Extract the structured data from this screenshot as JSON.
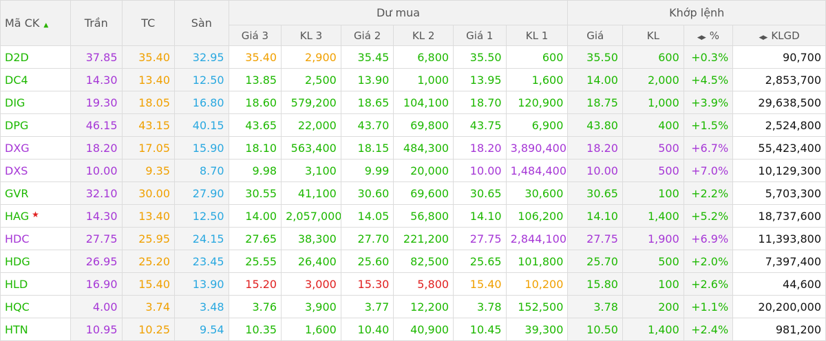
{
  "colors": {
    "ceiling": "#a637d6",
    "ref": "#f0a000",
    "floor": "#29a8e0",
    "up": "#1db800",
    "down": "#e02020",
    "neutral": "#111111"
  },
  "headers": {
    "symbol": "Mã CK",
    "ceiling": "Trần",
    "ref": "TC",
    "floor": "Sàn",
    "bid_group": "Dư mua",
    "match_group": "Khớp lệnh",
    "p3": "Giá 3",
    "v3": "KL 3",
    "p2": "Giá 2",
    "v2": "KL 2",
    "p1": "Giá 1",
    "v1": "KL 1",
    "mp": "Giá",
    "mv": "KL",
    "pct": "%",
    "total": "KLGD"
  },
  "icons": {
    "sort": "sort-up-icon",
    "toggle": "toggle-arrows-icon",
    "star": "star-icon"
  },
  "rows": [
    {
      "sym": "D2D",
      "c": "37.85",
      "r": "35.40",
      "f": "32.95",
      "p3": "35.40",
      "v3": "2,900",
      "p2": "35.45",
      "v2": "6,800",
      "p1": "35.50",
      "v1": "600",
      "mp": "35.50",
      "mv": "600",
      "pct": "+0.3%",
      "total": "90,700",
      "t": {
        "p3": "ref",
        "p2": "up",
        "p1": "up",
        "m": "up",
        "sym": "up"
      }
    },
    {
      "sym": "DC4",
      "c": "14.30",
      "r": "13.40",
      "f": "12.50",
      "p3": "13.85",
      "v3": "2,500",
      "p2": "13.90",
      "v2": "1,000",
      "p1": "13.95",
      "v1": "1,600",
      "mp": "14.00",
      "mv": "2,000",
      "pct": "+4.5%",
      "total": "2,853,700",
      "t": {
        "p3": "up",
        "p2": "up",
        "p1": "up",
        "m": "up",
        "sym": "up"
      }
    },
    {
      "sym": "DIG",
      "c": "19.30",
      "r": "18.05",
      "f": "16.80",
      "p3": "18.60",
      "v3": "579,200",
      "p2": "18.65",
      "v2": "104,100",
      "p1": "18.70",
      "v1": "120,900",
      "mp": "18.75",
      "mv": "1,000",
      "pct": "+3.9%",
      "total": "29,638,500",
      "t": {
        "p3": "up",
        "p2": "up",
        "p1": "up",
        "m": "up",
        "sym": "up"
      }
    },
    {
      "sym": "DPG",
      "c": "46.15",
      "r": "43.15",
      "f": "40.15",
      "p3": "43.65",
      "v3": "22,000",
      "p2": "43.70",
      "v2": "69,800",
      "p1": "43.75",
      "v1": "6,900",
      "mp": "43.80",
      "mv": "400",
      "pct": "+1.5%",
      "total": "2,524,800",
      "t": {
        "p3": "up",
        "p2": "up",
        "p1": "up",
        "m": "up",
        "sym": "up"
      }
    },
    {
      "sym": "DXG",
      "c": "18.20",
      "r": "17.05",
      "f": "15.90",
      "p3": "18.10",
      "v3": "563,400",
      "p2": "18.15",
      "v2": "484,300",
      "p1": "18.20",
      "v1": "3,890,400",
      "mp": "18.20",
      "mv": "500",
      "pct": "+6.7%",
      "total": "55,423,400",
      "t": {
        "p3": "up",
        "p2": "up",
        "p1": "ceiling",
        "m": "ceiling",
        "sym": "ceiling"
      }
    },
    {
      "sym": "DXS",
      "c": "10.00",
      "r": "9.35",
      "f": "8.70",
      "p3": "9.98",
      "v3": "3,100",
      "p2": "9.99",
      "v2": "20,000",
      "p1": "10.00",
      "v1": "1,484,400",
      "mp": "10.00",
      "mv": "500",
      "pct": "+7.0%",
      "total": "10,129,300",
      "t": {
        "p3": "up",
        "p2": "up",
        "p1": "ceiling",
        "m": "ceiling",
        "sym": "ceiling"
      }
    },
    {
      "sym": "GVR",
      "c": "32.10",
      "r": "30.00",
      "f": "27.90",
      "p3": "30.55",
      "v3": "41,100",
      "p2": "30.60",
      "v2": "69,600",
      "p1": "30.65",
      "v1": "30,600",
      "mp": "30.65",
      "mv": "100",
      "pct": "+2.2%",
      "total": "5,703,300",
      "t": {
        "p3": "up",
        "p2": "up",
        "p1": "up",
        "m": "up",
        "sym": "up"
      }
    },
    {
      "sym": "HAG",
      "star": true,
      "c": "14.30",
      "r": "13.40",
      "f": "12.50",
      "p3": "14.00",
      "v3": "2,057,000",
      "p2": "14.05",
      "v2": "56,800",
      "p1": "14.10",
      "v1": "106,200",
      "mp": "14.10",
      "mv": "1,400",
      "pct": "+5.2%",
      "total": "18,737,600",
      "t": {
        "p3": "up",
        "p2": "up",
        "p1": "up",
        "m": "up",
        "sym": "up"
      }
    },
    {
      "sym": "HDC",
      "c": "27.75",
      "r": "25.95",
      "f": "24.15",
      "p3": "27.65",
      "v3": "38,300",
      "p2": "27.70",
      "v2": "221,200",
      "p1": "27.75",
      "v1": "2,844,100",
      "mp": "27.75",
      "mv": "1,900",
      "pct": "+6.9%",
      "total": "11,393,800",
      "t": {
        "p3": "up",
        "p2": "up",
        "p1": "ceiling",
        "m": "ceiling",
        "sym": "ceiling"
      }
    },
    {
      "sym": "HDG",
      "c": "26.95",
      "r": "25.20",
      "f": "23.45",
      "p3": "25.55",
      "v3": "26,400",
      "p2": "25.60",
      "v2": "82,500",
      "p1": "25.65",
      "v1": "101,800",
      "mp": "25.70",
      "mv": "500",
      "pct": "+2.0%",
      "total": "7,397,400",
      "t": {
        "p3": "up",
        "p2": "up",
        "p1": "up",
        "m": "up",
        "sym": "up"
      }
    },
    {
      "sym": "HLD",
      "c": "16.90",
      "r": "15.40",
      "f": "13.90",
      "p3": "15.20",
      "v3": "3,000",
      "p2": "15.30",
      "v2": "5,800",
      "p1": "15.40",
      "v1": "10,200",
      "mp": "15.80",
      "mv": "100",
      "pct": "+2.6%",
      "total": "44,600",
      "t": {
        "p3": "down",
        "p2": "down",
        "p1": "ref",
        "m": "up",
        "sym": "up"
      }
    },
    {
      "sym": "HQC",
      "c": "4.00",
      "r": "3.74",
      "f": "3.48",
      "p3": "3.76",
      "v3": "3,900",
      "p2": "3.77",
      "v2": "12,200",
      "p1": "3.78",
      "v1": "152,500",
      "mp": "3.78",
      "mv": "200",
      "pct": "+1.1%",
      "total": "20,200,000",
      "t": {
        "p3": "up",
        "p2": "up",
        "p1": "up",
        "m": "up",
        "sym": "up"
      }
    },
    {
      "sym": "HTN",
      "c": "10.95",
      "r": "10.25",
      "f": "9.54",
      "p3": "10.35",
      "v3": "1,600",
      "p2": "10.40",
      "v2": "40,900",
      "p1": "10.45",
      "v1": "39,300",
      "mp": "10.50",
      "mv": "1,400",
      "pct": "+2.4%",
      "total": "981,200",
      "t": {
        "p3": "up",
        "p2": "up",
        "p1": "up",
        "m": "up",
        "sym": "up"
      }
    }
  ]
}
